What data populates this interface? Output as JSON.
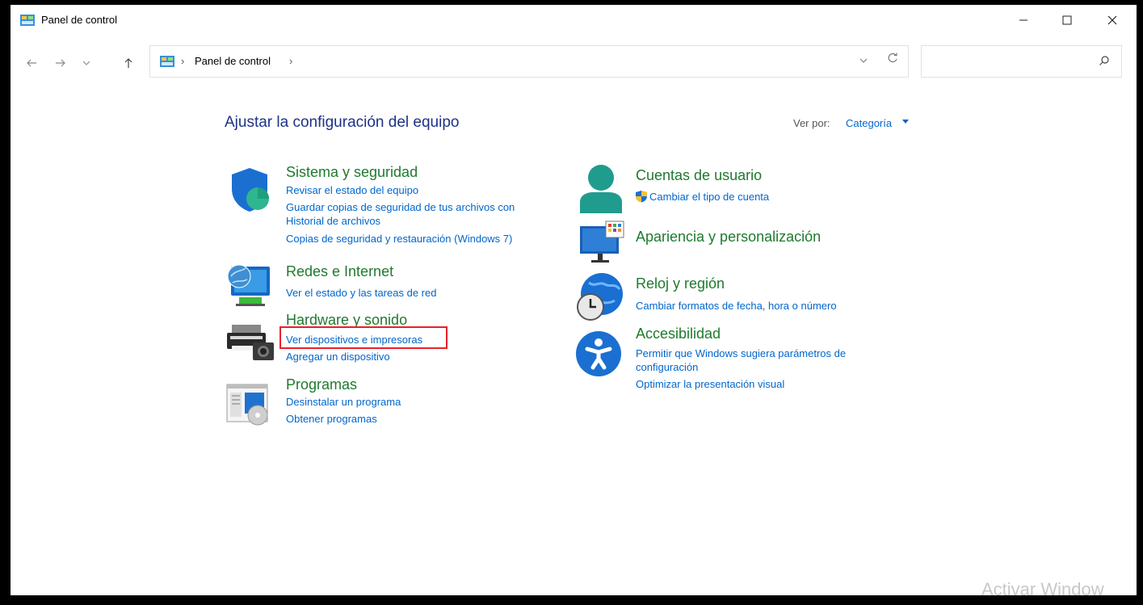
{
  "window": {
    "title": "Panel de control",
    "controls": {
      "minimize": "—",
      "maximize": "☐",
      "close": "✕"
    }
  },
  "nav": {
    "breadcrumb": "Panel de control",
    "search_placeholder": ""
  },
  "content": {
    "heading": "Ajustar la configuración del equipo",
    "view_by_label": "Ver por:",
    "view_by_value": "Categoría",
    "left": [
      {
        "title": "Sistema y seguridad",
        "links": [
          "Revisar el estado del equipo",
          "Guardar copias de seguridad de tus archivos con",
          "Historial de archivos",
          "Copias de seguridad y restauración (Windows 7)"
        ]
      },
      {
        "title": "Redes e Internet",
        "links": [
          "Ver el estado y las tareas de red"
        ]
      },
      {
        "title": "Hardware y sonido",
        "links": [
          "Ver dispositivos e impresoras",
          "Agregar un dispositivo"
        ]
      },
      {
        "title": "Programas",
        "links": [
          "Desinstalar un programa",
          "Obtener programas"
        ]
      }
    ],
    "right": [
      {
        "title": "Cuentas de usuario",
        "links": [
          "Cambiar el tipo de cuenta"
        ]
      },
      {
        "title": "Apariencia y personalización",
        "links": []
      },
      {
        "title": "Reloj y región",
        "links": [
          "Cambiar formatos de fecha, hora o número"
        ]
      },
      {
        "title": "Accesibilidad",
        "links": [
          "Permitir que Windows sugiera parámetros de",
          "configuración",
          "Optimizar la presentación visual"
        ]
      }
    ]
  },
  "watermark": "Activar Window",
  "colors": {
    "category_green": "#1f7a2e",
    "link_blue": "#0066cc",
    "heading_blue": "#1e3287",
    "highlight_red": "#e8202a"
  }
}
